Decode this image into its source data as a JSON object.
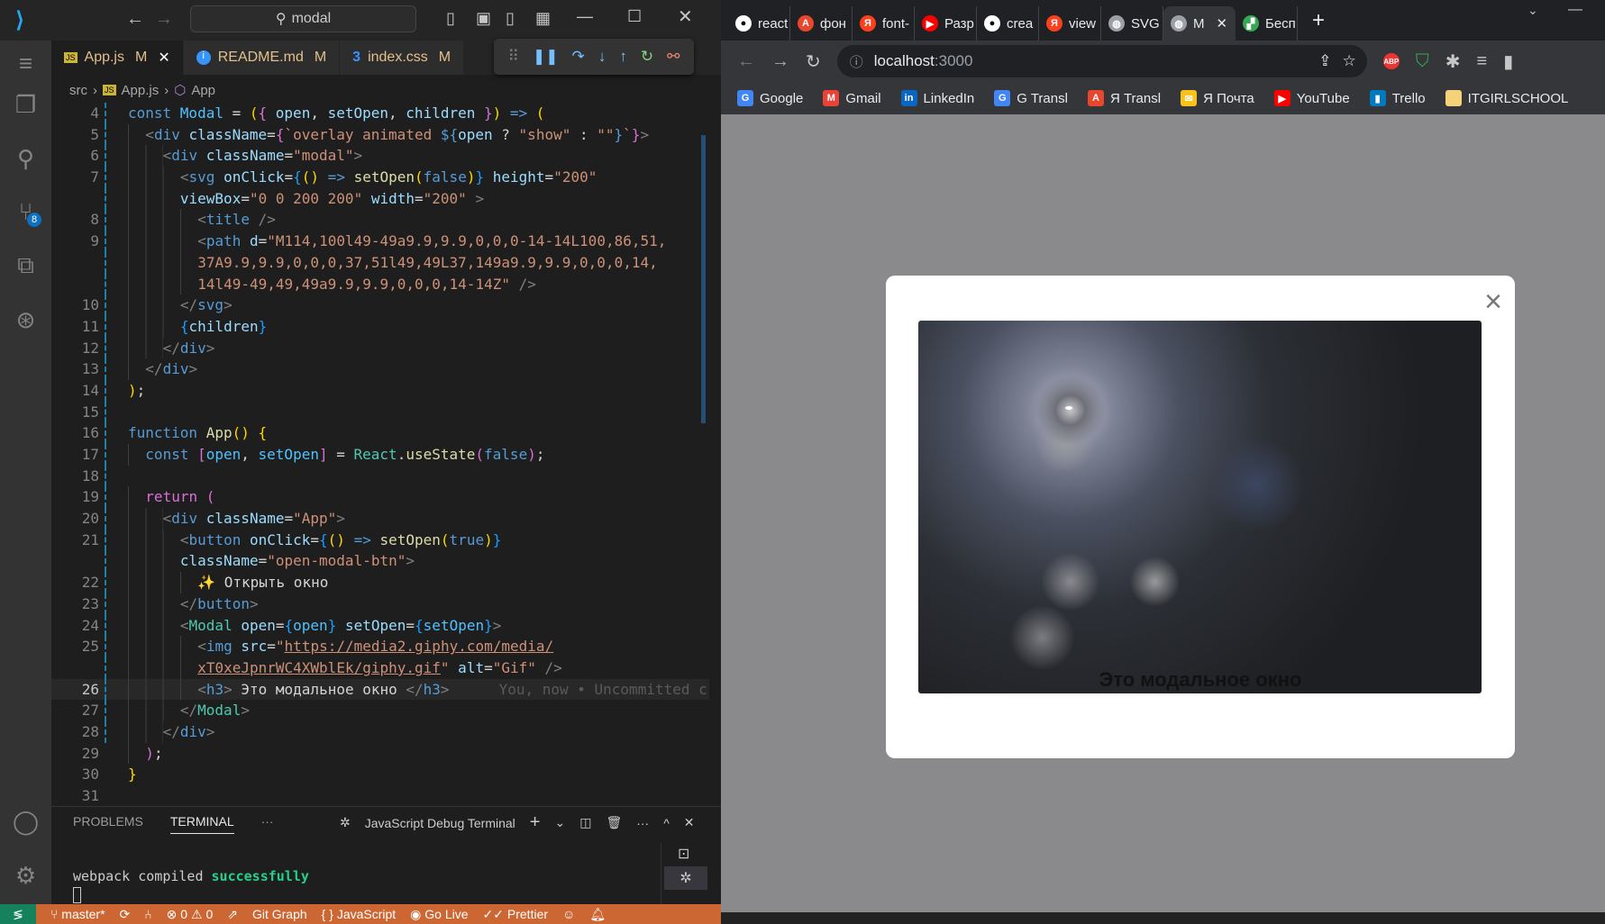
{
  "vscode": {
    "search": "modal",
    "tabs": [
      {
        "name": "App.js",
        "status": "M",
        "icon": "JS"
      },
      {
        "name": "README.md",
        "status": "M",
        "icon": "i"
      },
      {
        "name": "index.css",
        "status": "M",
        "icon": "3"
      }
    ],
    "breadcrumb": [
      "src",
      "App.js",
      "App"
    ],
    "scm_badge": "8",
    "code": [
      {
        "n": "4",
        "i": 0,
        "tk": [
          [
            "k",
            "const "
          ],
          [
            "c",
            "Modal"
          ],
          [
            "p",
            " = "
          ],
          [
            "b1",
            "("
          ],
          [
            "b2",
            "{"
          ],
          [
            "v",
            " open"
          ],
          [
            "p",
            ", "
          ],
          [
            "v",
            "setOpen"
          ],
          [
            "p",
            ", "
          ],
          [
            "v",
            "children"
          ],
          [
            "b2",
            " }"
          ],
          [
            "b1",
            ")"
          ],
          [
            "k",
            " =>"
          ],
          [
            "b1",
            " ("
          ]
        ]
      },
      {
        "n": "5",
        "i": 1,
        "tk": [
          [
            "g",
            "<"
          ],
          [
            "t",
            "div"
          ],
          [
            "v",
            " className"
          ],
          [
            "p",
            "="
          ],
          [
            "b2",
            "{"
          ],
          [
            "s",
            "`overlay animated "
          ],
          [
            "k",
            "${"
          ],
          [
            "v",
            "open"
          ],
          [
            "p",
            " ? "
          ],
          [
            "s",
            "\"show\""
          ],
          [
            "p",
            " : "
          ],
          [
            "s",
            "\"\""
          ],
          [
            "k",
            "}"
          ],
          [
            "s",
            "`"
          ],
          [
            "b2",
            "}"
          ],
          [
            "g",
            ">"
          ]
        ]
      },
      {
        "n": "6",
        "i": 2,
        "tk": [
          [
            "g",
            "<"
          ],
          [
            "t",
            "div"
          ],
          [
            "v",
            " className"
          ],
          [
            "p",
            "="
          ],
          [
            "s",
            "\"modal\""
          ],
          [
            "g",
            ">"
          ]
        ]
      },
      {
        "n": "7",
        "i": 3,
        "tk": [
          [
            "g",
            "<"
          ],
          [
            "t",
            "svg"
          ],
          [
            "v",
            " onClick"
          ],
          [
            "p",
            "="
          ],
          [
            "b3",
            "{"
          ],
          [
            "b1",
            "()"
          ],
          [
            "k",
            " =>"
          ],
          [
            "f",
            " setOpen"
          ],
          [
            "b1",
            "("
          ],
          [
            "k",
            "false"
          ],
          [
            "b1",
            ")"
          ],
          [
            "b3",
            "}"
          ],
          [
            "v",
            " height"
          ],
          [
            "p",
            "="
          ],
          [
            "s",
            "\"200\""
          ]
        ]
      },
      {
        "n": "",
        "i": 3,
        "tk": [
          [
            "v",
            "viewBox"
          ],
          [
            "p",
            "="
          ],
          [
            "s",
            "\"0 0 200 200\""
          ],
          [
            "v",
            " width"
          ],
          [
            "p",
            "="
          ],
          [
            "s",
            "\"200\""
          ],
          [
            "g",
            " >"
          ]
        ]
      },
      {
        "n": "8",
        "i": 4,
        "tk": [
          [
            "g",
            "<"
          ],
          [
            "t",
            "title"
          ],
          [
            "g",
            " />"
          ]
        ]
      },
      {
        "n": "9",
        "i": 4,
        "tk": [
          [
            "g",
            "<"
          ],
          [
            "t",
            "path"
          ],
          [
            "v",
            " d"
          ],
          [
            "p",
            "="
          ],
          [
            "s",
            "\"M114,100l49-49a9.9,9.9,0,0,0-14-14L100,86,51,"
          ]
        ]
      },
      {
        "n": "",
        "i": 4,
        "tk": [
          [
            "s",
            "37A9.9,9.9,0,0,0,37,51l49,49L37,149a9.9,9.9,0,0,0,14,"
          ]
        ]
      },
      {
        "n": "",
        "i": 4,
        "tk": [
          [
            "s",
            "14l49-49,49,49a9.9,9.9,0,0,0,14-14Z\""
          ],
          [
            "g",
            " />"
          ]
        ]
      },
      {
        "n": "10",
        "i": 3,
        "tk": [
          [
            "g",
            "</"
          ],
          [
            "t",
            "svg"
          ],
          [
            "g",
            ">"
          ]
        ]
      },
      {
        "n": "11",
        "i": 3,
        "tk": [
          [
            "b3",
            "{"
          ],
          [
            "v",
            "children"
          ],
          [
            "b3",
            "}"
          ]
        ]
      },
      {
        "n": "12",
        "i": 2,
        "tk": [
          [
            "g",
            "</"
          ],
          [
            "t",
            "div"
          ],
          [
            "g",
            ">"
          ]
        ]
      },
      {
        "n": "13",
        "i": 1,
        "tk": [
          [
            "g",
            "</"
          ],
          [
            "t",
            "div"
          ],
          [
            "g",
            ">"
          ]
        ]
      },
      {
        "n": "14",
        "i": 0,
        "tk": [
          [
            "b1",
            ")"
          ],
          [
            "p",
            ";"
          ]
        ]
      },
      {
        "n": "15",
        "i": 0,
        "tk": []
      },
      {
        "n": "16",
        "i": 0,
        "tk": [
          [
            "k",
            "function "
          ],
          [
            "f",
            "App"
          ],
          [
            "b1",
            "()"
          ],
          [
            "b1",
            " {"
          ]
        ]
      },
      {
        "n": "17",
        "i": 1,
        "tk": [
          [
            "k",
            "const "
          ],
          [
            "b2",
            "["
          ],
          [
            "c",
            "open"
          ],
          [
            "p",
            ", "
          ],
          [
            "c",
            "setOpen"
          ],
          [
            "b2",
            "]"
          ],
          [
            "p",
            " = "
          ],
          [
            "m2",
            "React"
          ],
          [
            "p",
            "."
          ],
          [
            "f",
            "useState"
          ],
          [
            "b2",
            "("
          ],
          [
            "k",
            "false"
          ],
          [
            "b2",
            ")"
          ],
          [
            "p",
            ";"
          ]
        ]
      },
      {
        "n": "18",
        "i": 0,
        "tk": []
      },
      {
        "n": "19",
        "i": 1,
        "tk": [
          [
            "b2",
            "return "
          ],
          [
            "b2",
            "("
          ]
        ]
      },
      {
        "n": "20",
        "i": 2,
        "tk": [
          [
            "g",
            "<"
          ],
          [
            "t",
            "div"
          ],
          [
            "v",
            " className"
          ],
          [
            "p",
            "="
          ],
          [
            "s",
            "\"App\""
          ],
          [
            "g",
            ">"
          ]
        ]
      },
      {
        "n": "21",
        "i": 3,
        "tk": [
          [
            "g",
            "<"
          ],
          [
            "t",
            "button"
          ],
          [
            "v",
            " onClick"
          ],
          [
            "p",
            "="
          ],
          [
            "b3",
            "{"
          ],
          [
            "b1",
            "()"
          ],
          [
            "k",
            " =>"
          ],
          [
            "f",
            " setOpen"
          ],
          [
            "b1",
            "("
          ],
          [
            "k",
            "true"
          ],
          [
            "b1",
            ")"
          ],
          [
            "b3",
            "}"
          ]
        ]
      },
      {
        "n": "",
        "i": 3,
        "tk": [
          [
            "v",
            "className"
          ],
          [
            "p",
            "="
          ],
          [
            "s",
            "\"open-modal-btn\""
          ],
          [
            "g",
            ">"
          ]
        ]
      },
      {
        "n": "22",
        "i": 4,
        "tk": [
          [
            "b1",
            "✨"
          ],
          [
            "p",
            " Открыть окно"
          ]
        ]
      },
      {
        "n": "23",
        "i": 3,
        "tk": [
          [
            "g",
            "</"
          ],
          [
            "t",
            "button"
          ],
          [
            "g",
            ">"
          ]
        ]
      },
      {
        "n": "24",
        "i": 3,
        "tk": [
          [
            "g",
            "<"
          ],
          [
            "m2",
            "Modal"
          ],
          [
            "v",
            " open"
          ],
          [
            "p",
            "="
          ],
          [
            "b3",
            "{"
          ],
          [
            "c",
            "open"
          ],
          [
            "b3",
            "}"
          ],
          [
            "v",
            " setOpen"
          ],
          [
            "p",
            "="
          ],
          [
            "b3",
            "{"
          ],
          [
            "c",
            "setOpen"
          ],
          [
            "b3",
            "}"
          ],
          [
            "g",
            ">"
          ]
        ]
      },
      {
        "n": "25",
        "i": 4,
        "tk": [
          [
            "g",
            "<"
          ],
          [
            "t",
            "img"
          ],
          [
            "v",
            " src"
          ],
          [
            "p",
            "="
          ],
          [
            "s",
            "\""
          ],
          [
            "u",
            "https://media2.giphy.com/media/"
          ]
        ]
      },
      {
        "n": "",
        "i": 4,
        "tk": [
          [
            "u",
            "xT0xeJpnrWC4XWblEk/giphy.gif"
          ],
          [
            "s",
            "\""
          ],
          [
            "v",
            " alt"
          ],
          [
            "p",
            "="
          ],
          [
            "s",
            "\"Gif\""
          ],
          [
            "g",
            " />"
          ]
        ]
      },
      {
        "n": "26",
        "i": 4,
        "cur": true,
        "tk": [
          [
            "g",
            "<"
          ],
          [
            "t",
            "h3"
          ],
          [
            "g",
            ">"
          ],
          [
            "p",
            " Это модальное окно "
          ],
          [
            "g",
            "</"
          ],
          [
            "t",
            "h3"
          ],
          [
            "g",
            ">"
          ],
          [
            "gh",
            "You, now • Uncommitted c"
          ]
        ]
      },
      {
        "n": "27",
        "i": 3,
        "tk": [
          [
            "g",
            "</"
          ],
          [
            "m2",
            "Modal"
          ],
          [
            "g",
            ">"
          ]
        ]
      },
      {
        "n": "28",
        "i": 2,
        "tk": [
          [
            "g",
            "</"
          ],
          [
            "t",
            "div"
          ],
          [
            "g",
            ">"
          ]
        ]
      },
      {
        "n": "29",
        "i": 1,
        "tk": [
          [
            "b2",
            ")"
          ],
          [
            "p",
            ";"
          ]
        ]
      },
      {
        "n": "30",
        "i": 0,
        "tk": [
          [
            "b1",
            "}"
          ]
        ]
      },
      {
        "n": "31",
        "i": 0,
        "tk": []
      }
    ],
    "panel": {
      "tabs": [
        "PROBLEMS",
        "TERMINAL"
      ],
      "more": "···",
      "terminal_name": "JavaScript Debug Terminal",
      "line1": "webpack compiled ",
      "line1_ok": "successfully"
    },
    "status": {
      "branch": "master*",
      "errors": "0",
      "warnings": "0",
      "git_graph": "Git Graph",
      "language": "JavaScript",
      "go_live": "Go Live",
      "prettier": "Prettier"
    }
  },
  "browser": {
    "tabs": [
      {
        "title": "react",
        "c": "#fff",
        "g": "●"
      },
      {
        "title": "фон",
        "c": "#e8462d",
        "g": "A"
      },
      {
        "title": "font-",
        "c": "#fc3f1d",
        "g": "Я"
      },
      {
        "title": "Разр",
        "c": "#ff0000",
        "g": "▶"
      },
      {
        "title": "crea",
        "c": "#fff",
        "g": "●"
      },
      {
        "title": "view",
        "c": "#fc3f1d",
        "g": "Я"
      },
      {
        "title": "SVG",
        "c": "#9aa0a6",
        "g": "◍"
      },
      {
        "title": "M",
        "c": "#9aa0a6",
        "g": "◍",
        "active": true
      },
      {
        "title": "Бесп",
        "c": "#34a853",
        "g": "▞"
      }
    ],
    "url_host": "localhost",
    "url_port": ":3000",
    "bookmarks": [
      {
        "t": "Google",
        "c": "#4285f4",
        "g": "G"
      },
      {
        "t": "Gmail",
        "c": "#ea4335",
        "g": "M"
      },
      {
        "t": "LinkedIn",
        "c": "#0a66c2",
        "g": "in"
      },
      {
        "t": "G Transl",
        "c": "#4285f4",
        "g": "G"
      },
      {
        "t": "Я Transl",
        "c": "#e8462d",
        "g": "A"
      },
      {
        "t": "Я Почта",
        "c": "#f8c21a",
        "g": "✉"
      },
      {
        "t": "YouTube",
        "c": "#ff0000",
        "g": "▶"
      },
      {
        "t": "Trello",
        "c": "#0079bf",
        "g": "▮"
      },
      {
        "t": "ITGIRLSCHOOL",
        "c": "#f4d27a",
        "g": " "
      }
    ],
    "modal": {
      "heading": "Это модальное окно",
      "close": "×",
      "image_alt": "Gif"
    }
  }
}
